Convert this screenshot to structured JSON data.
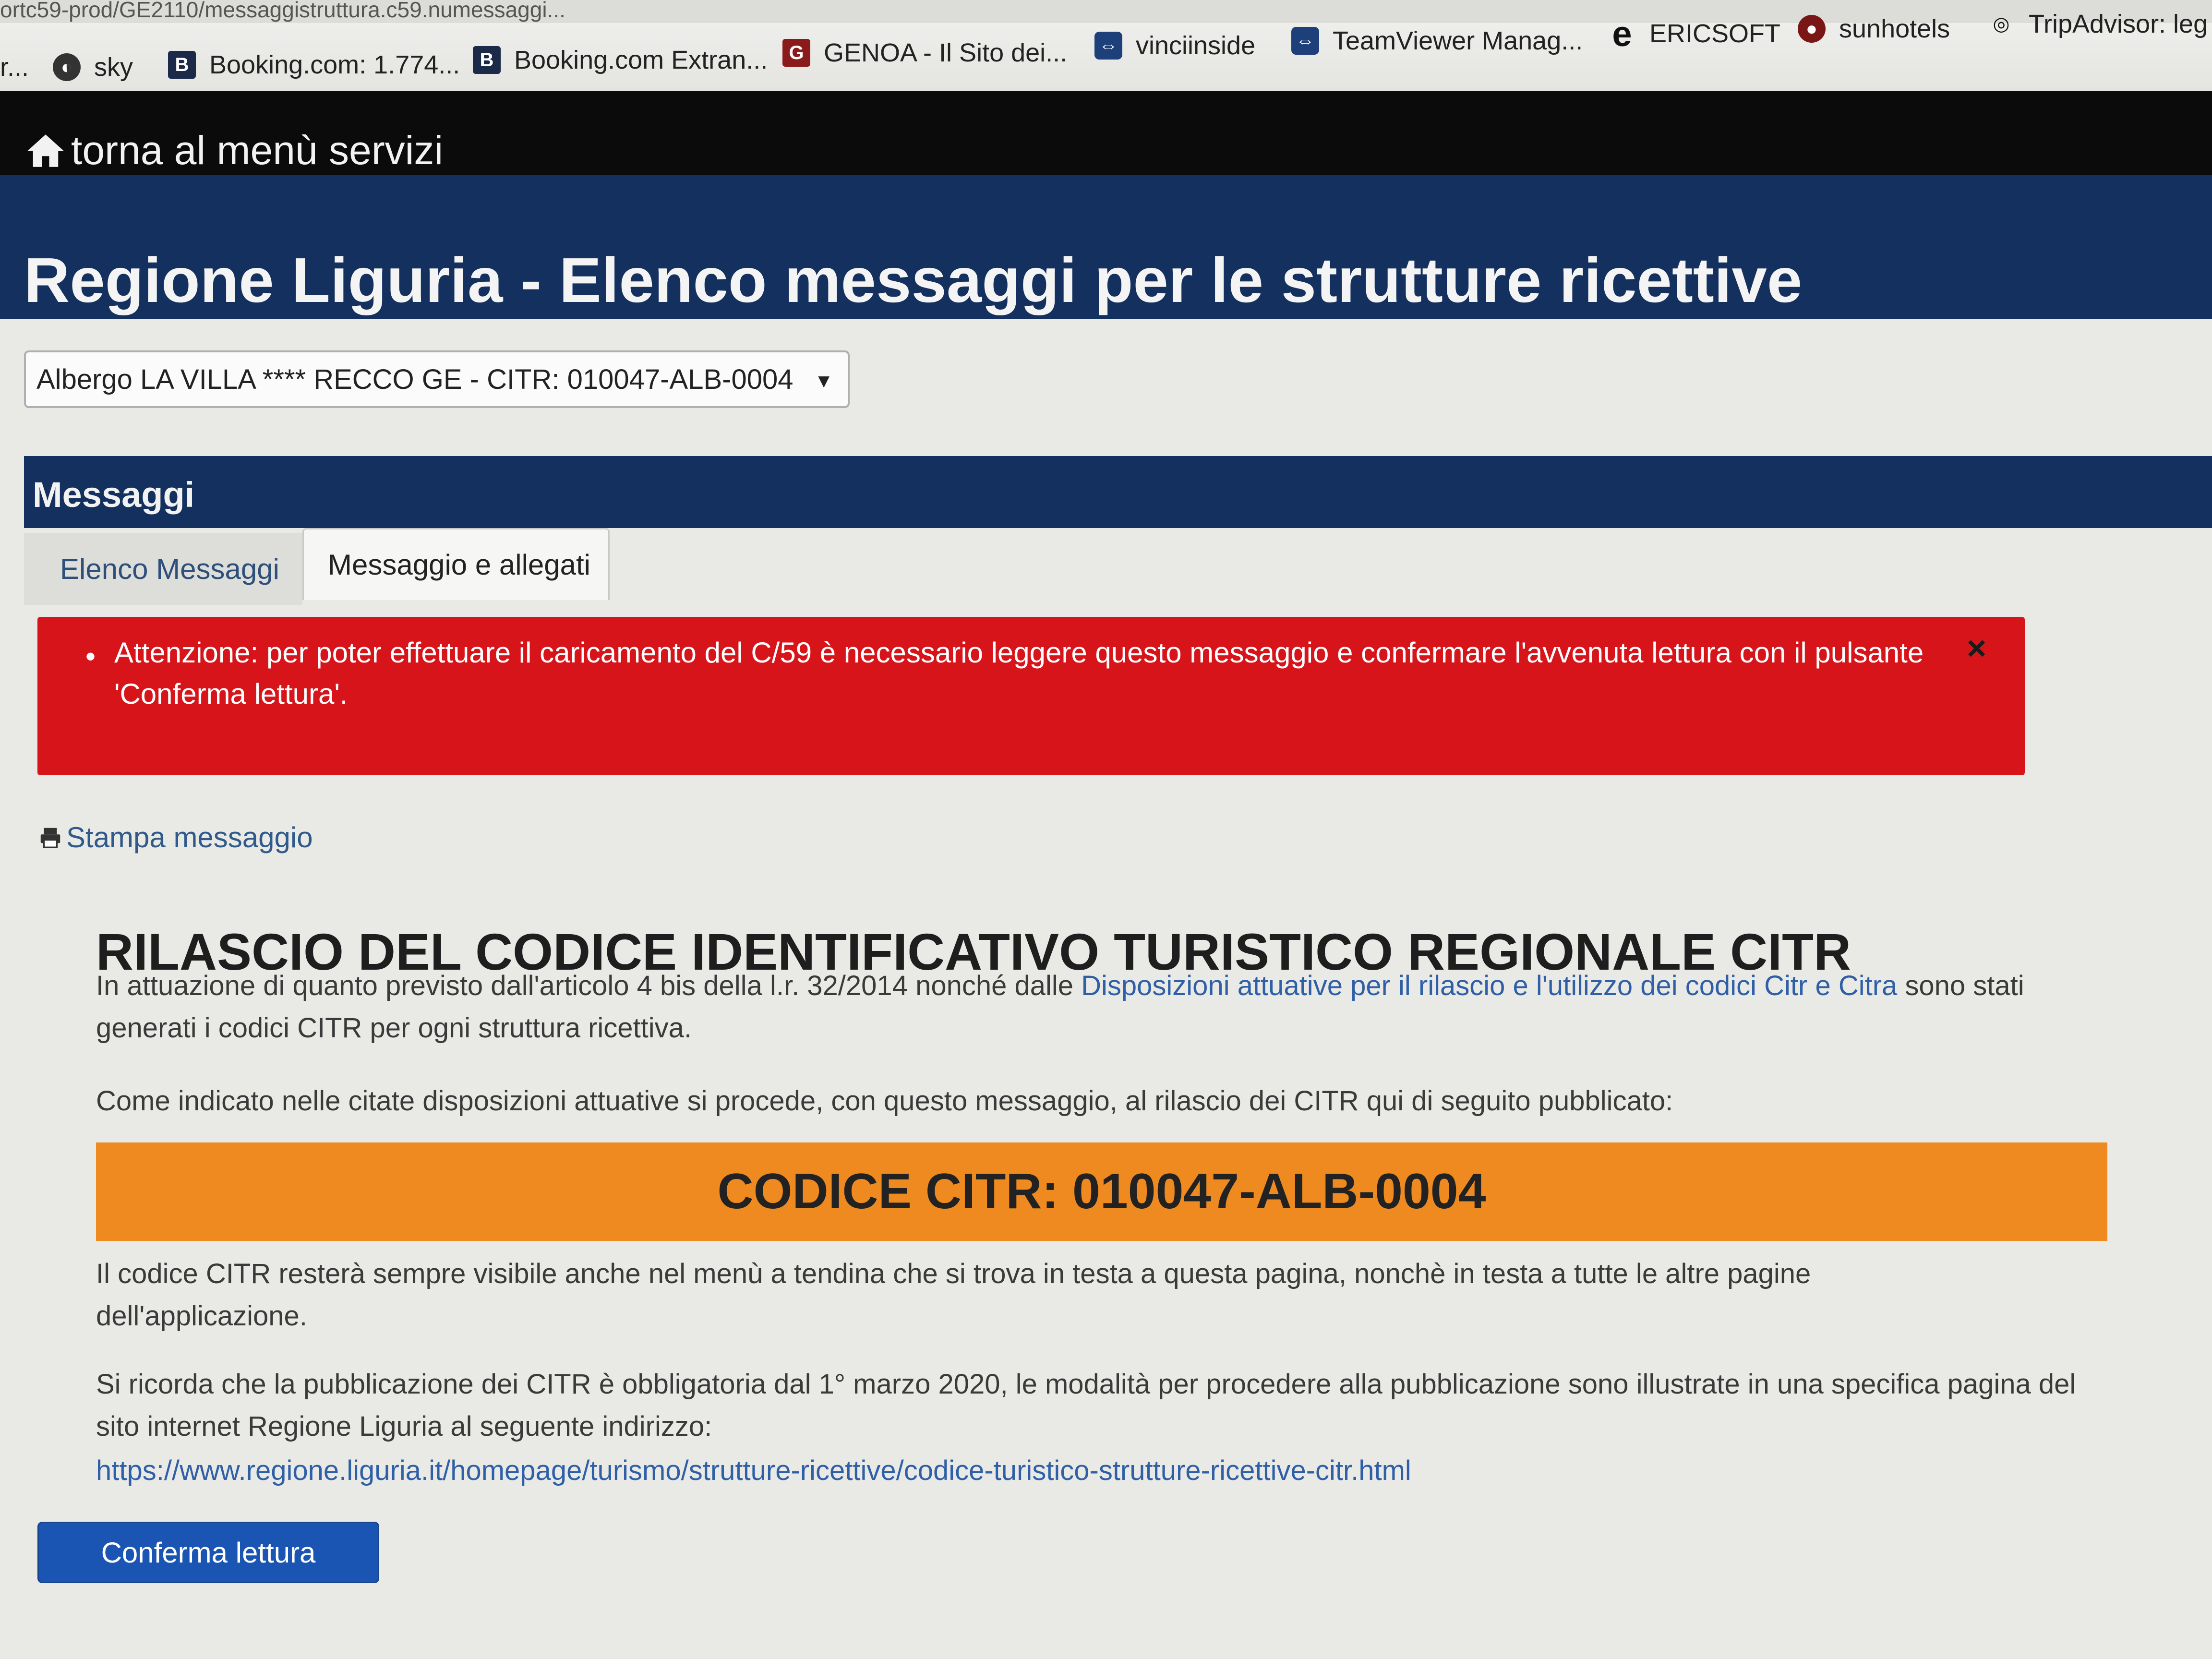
{
  "browser": {
    "url_fragment": "ortc59-prod/GE2110/messaggistruttura.c59.numessaggi...",
    "bookmarks": [
      {
        "label": "r...",
        "icon": "none"
      },
      {
        "label": "sky",
        "icon": "globe-icon"
      },
      {
        "label": "Booking.com: 1.774...",
        "icon": "booking-icon"
      },
      {
        "label": "Booking.com Extran...",
        "icon": "booking-icon"
      },
      {
        "label": "GENOA - Il Sito dei...",
        "icon": "genoa-icon"
      },
      {
        "label": "vinciinside",
        "icon": "teamviewer-icon"
      },
      {
        "label": "TeamViewer Manag...",
        "icon": "teamviewer-icon"
      },
      {
        "label": "ERICSOFT",
        "icon": "ie-icon"
      },
      {
        "label": "sunhotels",
        "icon": "sunhotels-icon"
      },
      {
        "label": "TripAdvisor: leg",
        "icon": "tripadvisor-icon"
      }
    ]
  },
  "nav": {
    "back_label": "torna al menù servizi"
  },
  "header": {
    "title": "Regione Liguria - Elenco messaggi per le strutture ricettive"
  },
  "structure_select": {
    "value": "Albergo LA VILLA **** RECCO GE - CITR: 010047-ALB-0004"
  },
  "panel": {
    "heading": "Messaggi",
    "tabs": [
      {
        "label": "Elenco Messaggi"
      },
      {
        "label": "Messaggio e allegati"
      }
    ]
  },
  "alert": {
    "text": "Attenzione: per poter effettuare il caricamento del C/59 è necessario leggere questo messaggio e confermare l'avvenuta lettura con il pulsante 'Conferma lettura'.",
    "close": "×"
  },
  "message": {
    "print_label": "Stampa messaggio",
    "title": "RILASCIO DEL CODICE IDENTIFICATIVO TURISTICO REGIONALE CITR",
    "p1_before": "In attuazione di quanto previsto dall'articolo 4 bis della l.r. 32/2014 nonché dalle ",
    "p1_link": "Disposizioni attuative per il rilascio e l'utilizzo dei codici Citr e Citra",
    "p1_after": " sono stati generati i codici CITR per ogni struttura ricettiva.",
    "p2": "Come indicato nelle citate disposizioni attuative si procede, con questo messaggio, al rilascio dei CITR qui di seguito pubblicato:",
    "code_label": "CODICE CITR: 010047-ALB-0004",
    "p3": "Il codice CITR resterà sempre visibile anche nel menù a tendina che si trova in testa a questa pagina, nonchè in testa a tutte le altre pagine dell'applicazione.",
    "p4": "Si ricorda che la pubblicazione dei CITR è obbligatoria dal 1° marzo 2020, le modalità per procedere alla pubblicazione sono illustrate in una specifica pagina del sito internet Regione Liguria al seguente indirizzo:",
    "url": "https://www.regione.liguria.it/homepage/turismo/strutture-ricettive/codice-turistico-strutture-ricettive-citr.html",
    "confirm_button": "Conferma lettura"
  }
}
